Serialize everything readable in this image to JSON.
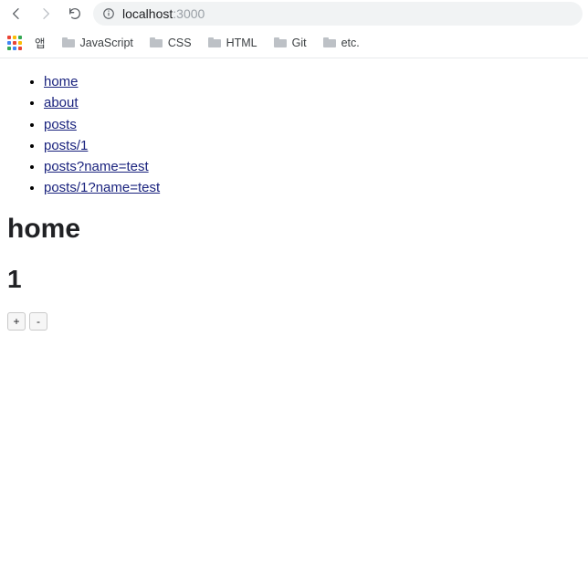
{
  "browser": {
    "url_host": "localhost",
    "url_port": ":3000"
  },
  "bookmarks": {
    "apps_colors": [
      "#ea4335",
      "#fbbc04",
      "#34a853",
      "#4285f4",
      "#ea4335",
      "#fbbc04",
      "#34a853",
      "#4285f4",
      "#ea4335"
    ],
    "items": [
      {
        "label": "앱",
        "folder": false
      },
      {
        "label": "JavaScript",
        "folder": true
      },
      {
        "label": "CSS",
        "folder": true
      },
      {
        "label": "HTML",
        "folder": true
      },
      {
        "label": "Git",
        "folder": true
      },
      {
        "label": "etc.",
        "folder": true
      }
    ]
  },
  "links": [
    "home",
    "about",
    "posts",
    "posts/1",
    "posts?name=test",
    "posts/1?name=test"
  ],
  "heading": "home",
  "counter": "1",
  "buttons": {
    "inc": "+",
    "dec": "-"
  }
}
